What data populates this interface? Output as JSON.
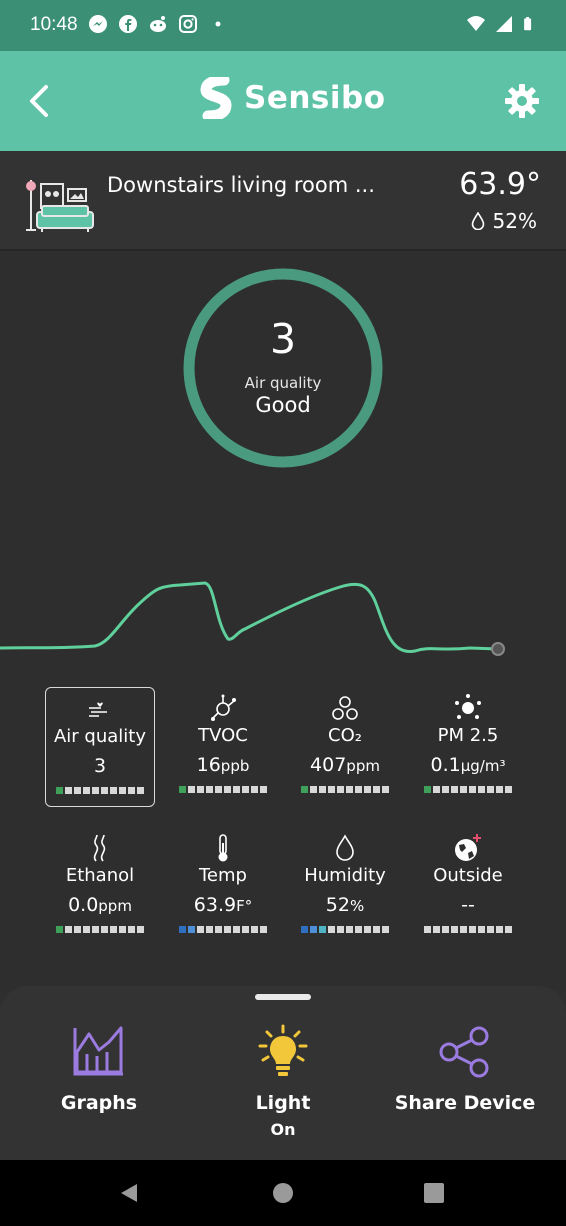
{
  "status_bar": {
    "time": "10:48",
    "left_icons": [
      "messenger-icon",
      "facebook-icon",
      "reddit-icon",
      "instagram-icon",
      "dot-icon"
    ],
    "right_icons": [
      "wifi-icon",
      "signal-icon",
      "battery-icon"
    ]
  },
  "app_bar": {
    "brand": "Sensibo",
    "background": "#5ec3a6",
    "status_background": "#3a8f75"
  },
  "device": {
    "name": "Downstairs living room ...",
    "temperature": "63.9°",
    "humidity": "52%"
  },
  "air_quality": {
    "value": "3",
    "label": "Air quality",
    "status": "Good",
    "ring_color": "#4a9a80"
  },
  "metrics": [
    {
      "name": "air-quality",
      "icon": "air-quality-icon",
      "label": "Air quality",
      "value": "3",
      "unit": "",
      "selected": true,
      "levels": [
        "#3fa05a",
        "#d8d8d8",
        "#d8d8d8",
        "#d8d8d8",
        "#d8d8d8",
        "#d8d8d8",
        "#d8d8d8",
        "#d8d8d8",
        "#d8d8d8",
        "#d8d8d8"
      ]
    },
    {
      "name": "tvoc",
      "icon": "tvoc-icon",
      "label": "TVOC",
      "value": "16",
      "unit": "ppb",
      "selected": false,
      "levels": [
        "#3fa05a",
        "#d8d8d8",
        "#d8d8d8",
        "#d8d8d8",
        "#d8d8d8",
        "#d8d8d8",
        "#d8d8d8",
        "#d8d8d8",
        "#d8d8d8",
        "#d8d8d8"
      ]
    },
    {
      "name": "co2",
      "icon": "co2-icon",
      "label": "CO₂",
      "value": "407",
      "unit": "ppm",
      "selected": false,
      "levels": [
        "#3fa05a",
        "#d8d8d8",
        "#d8d8d8",
        "#d8d8d8",
        "#d8d8d8",
        "#d8d8d8",
        "#d8d8d8",
        "#d8d8d8",
        "#d8d8d8",
        "#d8d8d8"
      ]
    },
    {
      "name": "pm25",
      "icon": "pm25-icon",
      "label": "PM 2.5",
      "value": "0.1",
      "unit": "µg/m³",
      "selected": false,
      "levels": [
        "#3fa05a",
        "#d8d8d8",
        "#d8d8d8",
        "#d8d8d8",
        "#d8d8d8",
        "#d8d8d8",
        "#d8d8d8",
        "#d8d8d8",
        "#d8d8d8",
        "#d8d8d8"
      ]
    },
    {
      "name": "ethanol",
      "icon": "ethanol-icon",
      "label": "Ethanol",
      "value": "0.0",
      "unit": "ppm",
      "selected": false,
      "levels": [
        "#3fa05a",
        "#d8d8d8",
        "#d8d8d8",
        "#d8d8d8",
        "#d8d8d8",
        "#d8d8d8",
        "#d8d8d8",
        "#d8d8d8",
        "#d8d8d8",
        "#d8d8d8"
      ]
    },
    {
      "name": "temp",
      "icon": "thermometer-icon",
      "label": "Temp",
      "value": "63.9",
      "unit": "F°",
      "selected": false,
      "levels": [
        "#2f6fbf",
        "#4f8fd8",
        "#d8d8d8",
        "#d8d8d8",
        "#d8d8d8",
        "#d8d8d8",
        "#d8d8d8",
        "#d8d8d8",
        "#d8d8d8",
        "#d8d8d8"
      ]
    },
    {
      "name": "humidity",
      "icon": "droplet-icon",
      "label": "Humidity",
      "value": "52",
      "unit": "%",
      "selected": false,
      "levels": [
        "#2f6fbf",
        "#4f8fd8",
        "#4fb4c8",
        "#d8d8d8",
        "#d8d8d8",
        "#d8d8d8",
        "#d8d8d8",
        "#d8d8d8",
        "#d8d8d8",
        "#d8d8d8"
      ]
    },
    {
      "name": "outside",
      "icon": "globe-plus-icon",
      "label": "Outside",
      "value": "--",
      "unit": "",
      "selected": false,
      "levels": [
        "#d8d8d8",
        "#d8d8d8",
        "#d8d8d8",
        "#d8d8d8",
        "#d8d8d8",
        "#d8d8d8",
        "#d8d8d8",
        "#d8d8d8",
        "#d8d8d8",
        "#d8d8d8"
      ]
    }
  ],
  "actions": [
    {
      "name": "graphs",
      "icon": "graphs-icon",
      "label": "Graphs",
      "sub": ""
    },
    {
      "name": "light",
      "icon": "lightbulb-icon",
      "label": "Light",
      "sub": "On"
    },
    {
      "name": "share-device",
      "icon": "share-icon",
      "label": "Share Device",
      "sub": ""
    }
  ],
  "colors": {
    "accent": "#5ec3a6",
    "graph_line": "#5fcf9b",
    "action_purple": "#9b7be0",
    "action_yellow": "#f3c73a"
  },
  "nav_icons": [
    "back-triangle-icon",
    "home-circle-icon",
    "recents-square-icon"
  ]
}
